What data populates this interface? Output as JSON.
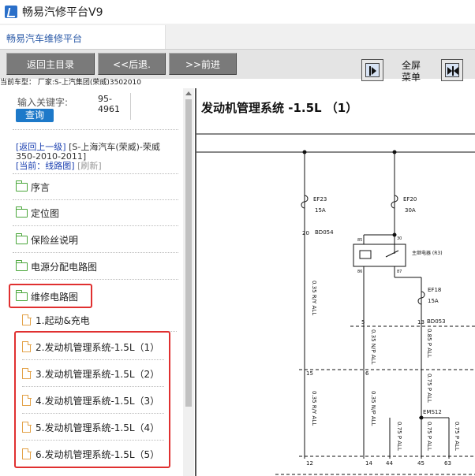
{
  "window": {
    "title": "畅易汽修平台V9"
  },
  "tab": {
    "label": "畅易汽车维修平台"
  },
  "toolbar": {
    "back_label": "返回主目录",
    "prev_label": "<<后退.",
    "next_label": ">>前进",
    "fullscreen_label_1": "全屏",
    "fullscreen_label_2": "菜单"
  },
  "car_type": "当前车型： 厂家:S-上汽集团(荣威)3502010",
  "search": {
    "label": "输入关键字:",
    "value_line1": "95-",
    "value_line2": "4961",
    "button": "查询"
  },
  "nav": {
    "up_link": "[返回上一级]",
    "path": "[S-上海汽车(荣威)-荣威350-2010-2011]",
    "current": "[当前：线路图]",
    "refresh": "[刷新]"
  },
  "tree": {
    "folders": [
      "序言",
      "定位图",
      "保险丝说明",
      "电源分配电路图",
      "维修电路图"
    ],
    "files": [
      "1.起动&充电",
      "2.发动机管理系统-1.5L（1）",
      "3.发动机管理系统-1.5L（2）",
      "4.发动机管理系统-1.5L（3）",
      "5.发动机管理系统-1.5L（4）",
      "6.发动机管理系统-1.5L（5）"
    ]
  },
  "diagram": {
    "title": "发动机管理系统 -1.5L （1）",
    "fuses": [
      {
        "name": "EF23",
        "rating": "15A"
      },
      {
        "name": "EF20",
        "rating": "30A"
      },
      {
        "name": "EF18",
        "rating": "15A"
      }
    ],
    "connectors": [
      "BD054",
      "BD053",
      "EMS12"
    ],
    "relay_label": "主继电器 (R3)",
    "relay_pins": [
      "85",
      "30",
      "86",
      "87"
    ],
    "pin_numbers": [
      "20",
      "5",
      "13",
      "15",
      "6",
      "12",
      "14",
      "44",
      "45",
      "63"
    ],
    "wires": [
      "0.35 R/Y ALL",
      "0.35 N/P ALL",
      "0.85 P ALL",
      "0.35 R/Y ALL",
      "0.35 N/P ALL",
      "0.75 P ALL",
      "0.75 P ALL",
      "0.75 P ALL",
      "0.75 P ALL"
    ]
  }
}
